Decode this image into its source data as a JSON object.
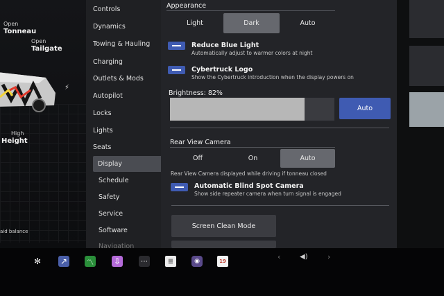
{
  "vehicle_panel": {
    "tonneau_status": "Open",
    "tonneau_label": "Tonneau",
    "tailgate_status": "Open",
    "tailgate_label": "Tailgate",
    "height_status": "High",
    "height_label": "Height",
    "bottom_text": "aid balance"
  },
  "menu": {
    "items": [
      "Controls",
      "Dynamics",
      "Towing & Hauling",
      "Charging",
      "Outlets & Mods",
      "Autopilot",
      "Locks",
      "Lights",
      "Seats",
      "Display",
      "Schedule",
      "Safety",
      "Service",
      "Software",
      "Navigation"
    ],
    "selected": "Display"
  },
  "display": {
    "appearance_title": "Appearance",
    "appearance_options": [
      "Light",
      "Dark",
      "Auto"
    ],
    "appearance_selected": "Dark",
    "reduce_blue_light": {
      "title": "Reduce Blue Light",
      "desc": "Automatically adjust to warmer colors at night",
      "enabled": true
    },
    "cybertruck_logo": {
      "title": "Cybertruck Logo",
      "desc": "Show the Cybertruck introduction when the display powers on",
      "enabled": true
    },
    "brightness_label": "Brightness: 82%",
    "brightness_value": 0.82,
    "brightness_auto": "Auto",
    "rear_camera_title": "Rear View Camera",
    "rear_camera_options": [
      "Off",
      "On",
      "Auto"
    ],
    "rear_camera_selected": "Auto",
    "rear_camera_desc": "Rear View Camera displayed while driving if tonneau closed",
    "blind_spot": {
      "title": "Automatic Blind Spot Camera",
      "desc": "Show side repeater camera when turn signal is engaged",
      "enabled": true
    },
    "screen_clean": "Screen Clean Mode"
  },
  "dock": {
    "calendar_day": "19",
    "icons": [
      "fan-icon",
      "autopilot-icon",
      "energy-chart-icon",
      "toybox-icon",
      "more-apps-icon",
      "manual-icon",
      "camera-icon",
      "calendar-icon"
    ],
    "accent": "#3f5bb2"
  }
}
